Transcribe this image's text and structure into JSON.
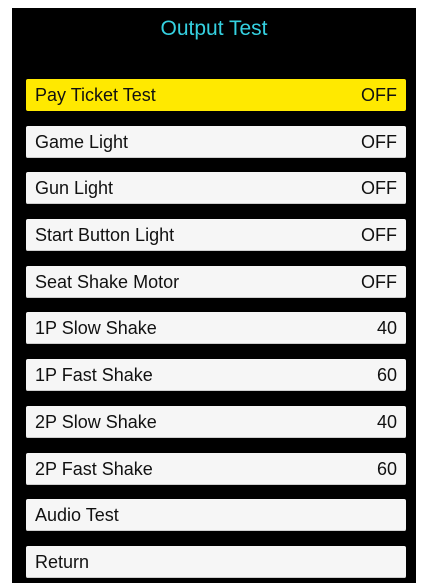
{
  "screen": {
    "title": "Output Test",
    "title_color": "#35d1e1",
    "selected_color": "#ffe900",
    "background": "#000000"
  },
  "menu": {
    "items": [
      {
        "label": "Pay Ticket Test",
        "value": "OFF",
        "selected": true
      },
      {
        "label": "Game Light",
        "value": "OFF"
      },
      {
        "label": "Gun Light",
        "value": "OFF"
      },
      {
        "label": "Start Button Light",
        "value": "OFF"
      },
      {
        "label": " Seat Shake Motor",
        "value": "OFF"
      },
      {
        "label": "1P Slow Shake",
        "value": "40"
      },
      {
        "label": "1P Fast Shake",
        "value": "60"
      },
      {
        "label": "2P Slow Shake",
        "value": "40"
      },
      {
        "label": "2P Fast Shake",
        "value": "60"
      },
      {
        "label": "Audio Test"
      },
      {
        "label": "Return"
      }
    ]
  }
}
